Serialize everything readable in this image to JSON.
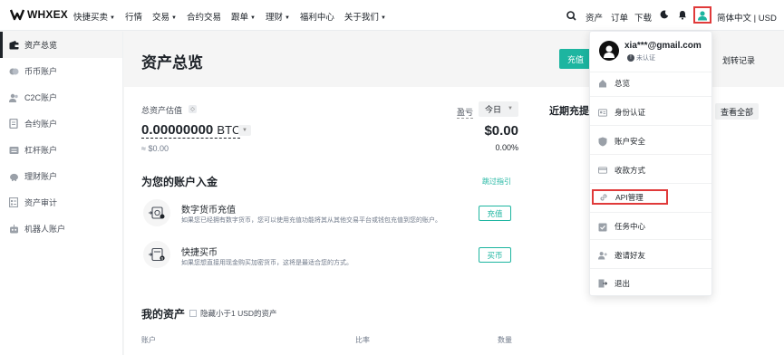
{
  "brand": {
    "name": "WHXEX"
  },
  "nav": {
    "items": [
      {
        "label": "快捷买卖",
        "has_caret": true
      },
      {
        "label": "行情",
        "has_caret": false
      },
      {
        "label": "交易",
        "has_caret": true
      },
      {
        "label": "合约交易",
        "has_caret": false
      },
      {
        "label": "跟单",
        "has_caret": true
      },
      {
        "label": "理财",
        "has_caret": true
      },
      {
        "label": "福利中心",
        "has_caret": false
      },
      {
        "label": "关于我们",
        "has_caret": true
      }
    ],
    "right": {
      "assets": "资产",
      "orders": "订单",
      "download": "下载",
      "lang_currency": "简体中文 | USD"
    }
  },
  "sidebar": {
    "items": [
      {
        "label": "资产总览",
        "icon": "wallet-icon",
        "active": true
      },
      {
        "label": "币币账户",
        "icon": "coin-icon",
        "active": false
      },
      {
        "label": "C2C账户",
        "icon": "people-icon",
        "active": false
      },
      {
        "label": "合约账户",
        "icon": "document-icon",
        "active": false
      },
      {
        "label": "杠杆账户",
        "icon": "leverage-icon",
        "active": false
      },
      {
        "label": "理财账户",
        "icon": "piggy-bank-icon",
        "active": false
      },
      {
        "label": "资产审计",
        "icon": "audit-icon",
        "active": false
      },
      {
        "label": "机器人账户",
        "icon": "robot-icon",
        "active": false
      }
    ]
  },
  "header": {
    "title": "资产总览",
    "deposit_button": "充值",
    "transfer_record": "划转记录"
  },
  "summary": {
    "estimate_label": "总资产估值",
    "btc_value": "0.00000000",
    "btc_unit": "BTC",
    "usd_approx": "≈ $0.00",
    "pnl_label": "盈亏",
    "period": "今日",
    "pnl_amount": "$0.00",
    "pnl_percent": "0.00%"
  },
  "recent": {
    "title": "近期充提",
    "view_all": "查看全部"
  },
  "deposit_section": {
    "title": "为您的账户入金",
    "skip_guide": "跳过指引",
    "rows": [
      {
        "title": "数字货币充值",
        "desc": "如果您已经拥有数字货币，您可以使用充值功能将其从其他交易平台或钱包充值到您的账户。",
        "button": "充值"
      },
      {
        "title": "快捷买币",
        "desc": "如果您想直接用现金购买加密货币，这将是最适合您的方式。",
        "button": "买币"
      }
    ]
  },
  "my_assets": {
    "title": "我的资产",
    "hide_small": "隐藏小于1 USD的资产",
    "columns": [
      "账户",
      "比率",
      "数量"
    ]
  },
  "user_menu": {
    "email": "xia***@gmail.com",
    "verify_status": "未认证",
    "items": [
      {
        "label": "总览",
        "icon": "home-icon",
        "highlighted": false
      },
      {
        "label": "身份认证",
        "icon": "id-card-icon",
        "highlighted": false
      },
      {
        "label": "账户安全",
        "icon": "shield-icon",
        "highlighted": false
      },
      {
        "label": "收款方式",
        "icon": "card-icon",
        "highlighted": false
      },
      {
        "label": "API管理",
        "icon": "link-icon",
        "highlighted": true
      },
      {
        "label": "任务中心",
        "icon": "task-icon",
        "highlighted": false
      },
      {
        "label": "邀请好友",
        "icon": "add-user-icon",
        "highlighted": false
      },
      {
        "label": "退出",
        "icon": "logout-icon",
        "highlighted": false
      }
    ]
  },
  "colors": {
    "accent": "#1db5a0",
    "highlight_box": "#e03a3a",
    "text_primary": "#1e2329",
    "text_secondary": "#707a8a"
  }
}
